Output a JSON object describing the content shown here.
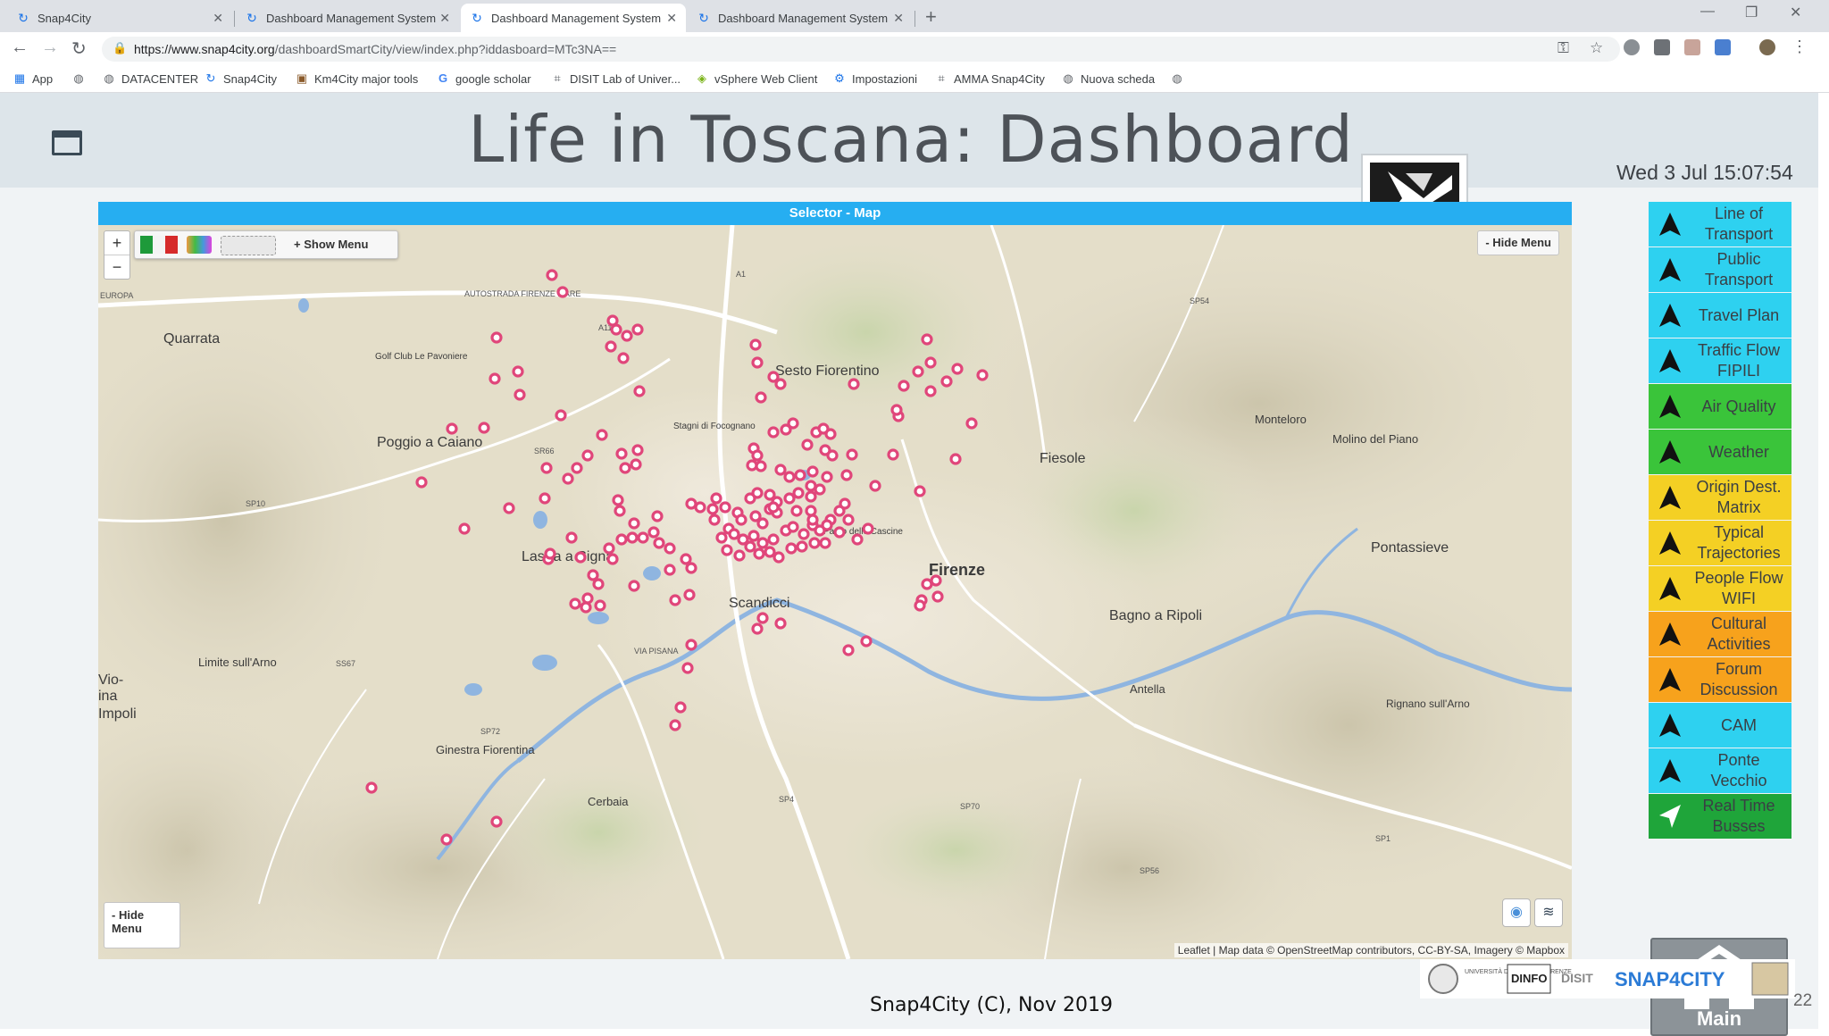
{
  "browser": {
    "tabs": [
      {
        "label": "Snap4City"
      },
      {
        "label": "Dashboard Management System"
      },
      {
        "label": "Dashboard Management System"
      },
      {
        "label": "Dashboard Management System"
      }
    ],
    "url_base": "https://www.snap4city.org",
    "url_path": "/dashboardSmartCity/view/index.php?iddasboard=MTc3NA==",
    "bookmarks": [
      {
        "label": "App"
      },
      {
        "label": ""
      },
      {
        "label": "DATACENTER"
      },
      {
        "label": "Snap4City"
      },
      {
        "label": "Km4City major tools"
      },
      {
        "label": "google scholar"
      },
      {
        "label": "DISIT Lab of Univer..."
      },
      {
        "label": "vSphere Web Client"
      },
      {
        "label": "Impostazioni"
      },
      {
        "label": "AMMA Snap4City"
      },
      {
        "label": "Nuova scheda"
      }
    ]
  },
  "dashboard": {
    "title": "Life in Toscana: Dashboard",
    "clock": "Wed 3 Jul 15:07:54",
    "logo_text": "SM"
  },
  "map_widget": {
    "title": "Selector - Map",
    "zoom_in": "+",
    "zoom_out": "−",
    "show_menu": "+ Show Menu",
    "hide_menu_right": "- Hide Menu",
    "hide_menu_left": "- Hide Menu",
    "attribution": "Leaflet | Map data © OpenStreetMap contributors, CC-BY-SA, Imagery © Mapbox",
    "places": [
      "Quarrata",
      "Poggio a Caiano",
      "Sesto Fiorentino",
      "Fiesole",
      "Firenze",
      "Lastra a Signa",
      "Scandicci",
      "Bagno a Ripoli",
      "Pontassieve",
      "Monteloro",
      "Molino del Piano",
      "Limite sull'Arno",
      "Ginestra Fiorentina",
      "Antella",
      "Rignano sull'Arno",
      "Cerbaia",
      "Golf Club Le Pavoniere",
      "Stagni di Focognano",
      "Parco delle Cascine",
      "Impoli",
      "Vio-",
      "ina"
    ],
    "road_labels": [
      "A1",
      "A11",
      "SR66",
      "SP10",
      "SS67",
      "SP72",
      "SP4",
      "SP70",
      "SP54",
      "SP56",
      "SP1",
      "AUTOSTRADA FIRENZE MARE",
      "VIA PISANA",
      "EUROPA"
    ]
  },
  "side_menu": {
    "items": [
      {
        "label": "Line of Transport",
        "color": "#2ed1f0"
      },
      {
        "label": "Public Transport",
        "color": "#2ed1f0"
      },
      {
        "label": "Travel Plan",
        "color": "#2ed1f0"
      },
      {
        "label": "Traffic Flow FIPILI",
        "color": "#2ed1f0"
      },
      {
        "label": "Air Quality",
        "color": "#3ac43a"
      },
      {
        "label": "Weather",
        "color": "#3ac43a"
      },
      {
        "label": "Origin Dest. Matrix",
        "color": "#f4d024"
      },
      {
        "label": "Typical Trajectories",
        "color": "#f4d024"
      },
      {
        "label": "People Flow WIFI",
        "color": "#f4d024"
      },
      {
        "label": "Cultural Activities",
        "color": "#f7a21c"
      },
      {
        "label": "Forum Discussion",
        "color": "#f7a21c"
      },
      {
        "label": "CAM",
        "color": "#2ed1f0"
      },
      {
        "label": "Ponte Vecchio",
        "color": "#2ed1f0"
      },
      {
        "label": "Real Time Busses",
        "color": "#1fa53a"
      }
    ],
    "main_label": "Main"
  },
  "footer": {
    "text": "Snap4City (C), Nov 2019",
    "page_number": "22",
    "logos": [
      "UNIVERSITÀ DEGLI STUDI FIRENZE",
      "DINFO",
      "DISIT",
      "SNAP4CITY"
    ]
  }
}
